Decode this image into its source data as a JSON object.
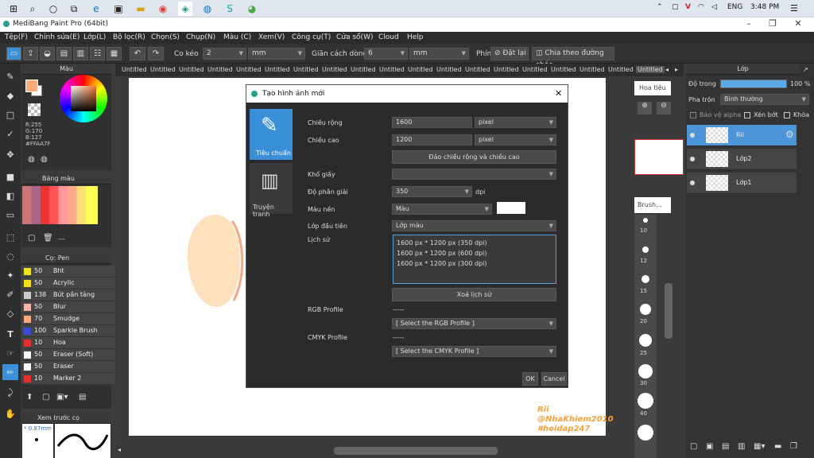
{
  "taskbar": {
    "lang": "ENG",
    "time": "3:48 PM"
  },
  "app": {
    "title": "MediBang Paint Pro (64bit)"
  },
  "menu": [
    "Tệp(F)",
    "Chỉnh sửa(E)",
    "Lớp(L)",
    "Bộ lọc(R)",
    "Chọn(S)",
    "Chụp(N)",
    "Màu (C)",
    "Xem(V)",
    "Công cụ(T)",
    "Cửa sổ(W)",
    "Cloud",
    "Help"
  ],
  "toolbar": {
    "co_keo_label": "Co kéo",
    "co_keo_value": "2",
    "unit1": "mm",
    "gian_cach_label": "Giãn cách dòng",
    "gian_cach_value": "6",
    "unit2": "mm",
    "phim_label": "Phím",
    "reset_label": "Đặt lại",
    "split_label": "Chia theo đường chéo"
  },
  "tabs": {
    "label": "Untitled"
  },
  "color_panel": {
    "title": "Màu",
    "r": "R:255",
    "g": "G:170",
    "b": "B:127",
    "hex": "#FFAA7F"
  },
  "palette_panel": {
    "title": "Bảng màu",
    "dash": "---"
  },
  "brush_panel": {
    "title": "Cọ: Pen",
    "items": [
      {
        "size": "50",
        "name": "Bht",
        "color": "#f3e21b"
      },
      {
        "size": "50",
        "name": "Acrylic",
        "color": "#f3e21b"
      },
      {
        "size": "138",
        "name": "Bút pần tảng",
        "color": "#cccccc"
      },
      {
        "size": "50",
        "name": "Blur",
        "color": "#f7b5a7"
      },
      {
        "size": "70",
        "name": "Smudge",
        "color": "#ffaa7f"
      },
      {
        "size": "100",
        "name": "Sparkle Brush",
        "color": "#3a4bd6"
      },
      {
        "size": "10",
        "name": "Hoa",
        "color": "#e53030"
      },
      {
        "size": "50",
        "name": "Eraser (Soft)",
        "color": "#ffffff"
      },
      {
        "size": "50",
        "name": "Eraser",
        "color": "#ffffff"
      },
      {
        "size": "10",
        "name": "Marker 2",
        "color": "#e53030"
      }
    ]
  },
  "preview_panel": {
    "title": "Xem trước cọ",
    "size": "* 0.87mm"
  },
  "dialog": {
    "title": "Tạo hình ảnh mới",
    "side_standard": "Tiêu chuẩn",
    "side_comic": "Truyện tranh",
    "width_label": "Chiều rộng",
    "width_value": "1600",
    "width_unit": "pixel",
    "height_label": "Chiều cao",
    "height_value": "1200",
    "height_unit": "pixel",
    "swap_button": "Đảo chiều rộng và chiều cao",
    "paper_label": "Khổ giấy",
    "dpi_label": "Độ phân giải",
    "dpi_value": "350",
    "dpi_unit": "dpi",
    "bg_label": "Màu nền",
    "bg_value": "Màu",
    "first_layer_label": "Lớp đầu tiên",
    "first_layer_value": "Lớp màu",
    "history_label": "Lịch sử",
    "history": [
      "1600 px * 1200 px (350 dpi)",
      "1600 px * 1200 px (600 dpi)",
      "1600 px * 1200 px (300 dpi)"
    ],
    "clear_history": "Xoá lịch sử",
    "rgb_label": "RGB Profile",
    "rgb_dash": "-----",
    "rgb_select": "[ Select the RGB Profile ]",
    "cmyk_label": "CMYK Profile",
    "cmyk_dash": "-----",
    "cmyk_select": "[ Select the CMYK Profile ]",
    "ok": "OK",
    "cancel": "Cancel"
  },
  "navigator": {
    "title": "Hoa tiêu"
  },
  "brush_size_panel": {
    "title": "Brush...",
    "sizes": [
      "10",
      "12",
      "15",
      "20",
      "25",
      "30",
      "40"
    ]
  },
  "layer_panel": {
    "title": "Lớp",
    "opacity_label": "Độ trong",
    "opacity_value": "100 %",
    "opacity_pct": 100,
    "blend_label": "Pha trộn",
    "blend_value": "Bình thường",
    "protect_alpha": "Bảo vệ alpha",
    "clip": "Xén bớt",
    "lock": "Khóa",
    "layers": [
      {
        "name": "Rii",
        "active": true
      },
      {
        "name": "Lớp2",
        "active": false
      },
      {
        "name": "Lớp1",
        "active": false
      }
    ]
  },
  "watermark": {
    "line1": "Rii",
    "line2": "@NhaKhiem2010",
    "line3": "#hoidap247"
  }
}
